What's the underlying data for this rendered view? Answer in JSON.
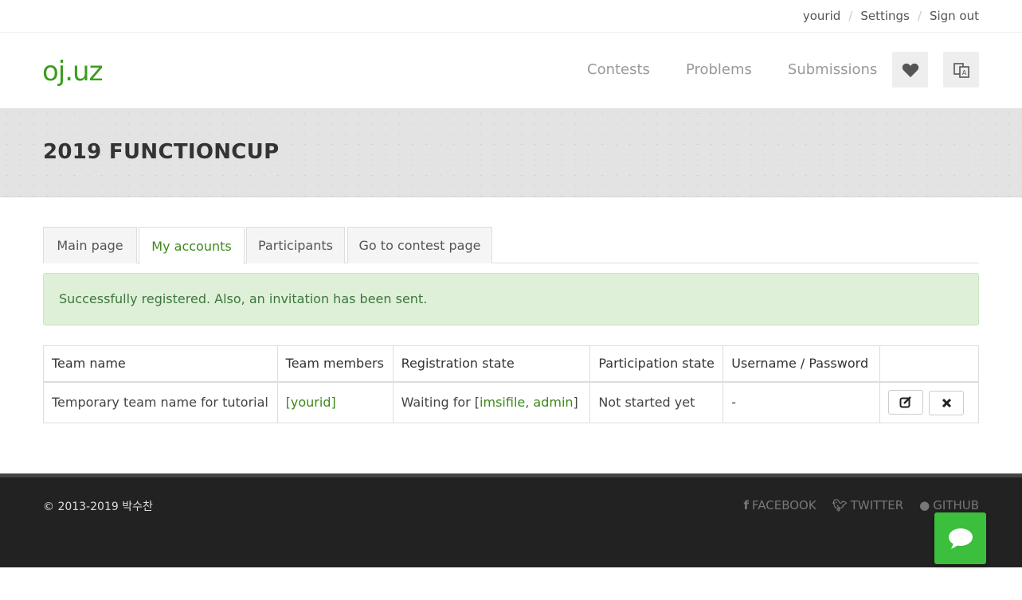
{
  "topbar": {
    "user": "yourid",
    "sep": "/",
    "settings": "Settings",
    "signout": "Sign out"
  },
  "logo": "oj.uz",
  "nav": {
    "contests": "Contests",
    "problems": "Problems",
    "submissions": "Submissions"
  },
  "header_icons": {
    "heart": "heart-icon",
    "language": "language-icon"
  },
  "banner_title": "2019 FUNCTIONCUP",
  "tabs": [
    {
      "label": "Main page",
      "active": false
    },
    {
      "label": "My accounts",
      "active": true
    },
    {
      "label": "Participants",
      "active": false
    },
    {
      "label": "Go to contest page",
      "active": false
    }
  ],
  "alert": "Successfully registered. Also, an invitation has been sent.",
  "table": {
    "headers": [
      "Team name",
      "Team members",
      "Registration state",
      "Participation state",
      "Username / Password",
      ""
    ],
    "row": {
      "team_name": "Temporary team name for tutorial",
      "members_open": "[",
      "member": "yourid",
      "members_close": "]",
      "reg_prefix": "Waiting for [",
      "reg_users": "imsifile, admin",
      "reg_suffix": "]",
      "participation": "Not started yet",
      "credentials": "-"
    }
  },
  "footer": {
    "copyright": "© 2013-2019 박수찬",
    "facebook": "FACEBOOK",
    "twitter": "TWITTER",
    "github": "GITHUB"
  },
  "colors": {
    "brand": "#3b9d1f",
    "alert_bg": "#dff0d8",
    "chat": "#3cbf3c",
    "footer": "#222222"
  }
}
